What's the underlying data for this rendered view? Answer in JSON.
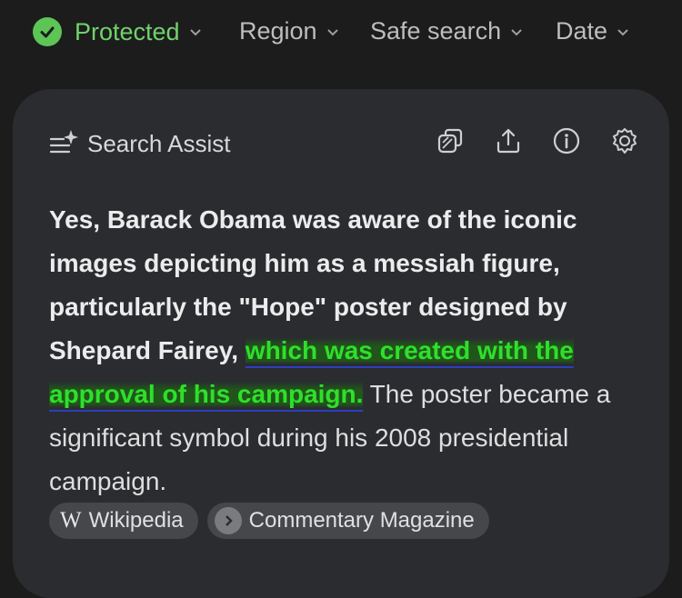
{
  "filters": {
    "protected": "Protected",
    "region": "Region",
    "safe_search": "Safe search",
    "date": "Date"
  },
  "assist": {
    "title": "Search Assist",
    "icons": [
      "copy-icon",
      "share-icon",
      "info-icon",
      "settings-icon"
    ]
  },
  "answer": {
    "part1": "Yes, Barack Obama was aware of the iconic images depicting him as a messiah figure, particularly the \"Hope\" poster designed by Shepard Fairey, ",
    "highlight": "which was created with the approval of his campaign.",
    "part2": " The poster became a significant symbol during his 2008 presidential campaign."
  },
  "sources": [
    {
      "icon": "W",
      "label": "Wikipedia"
    },
    {
      "icon": "chevron-right-icon",
      "label": "Commentary Magazine"
    }
  ],
  "colors": {
    "background": "#1c1c1c",
    "card": "#2a2c30",
    "protected_green": "#5cc556",
    "highlight_text": "#2ee02a",
    "chip": "#45474b"
  }
}
